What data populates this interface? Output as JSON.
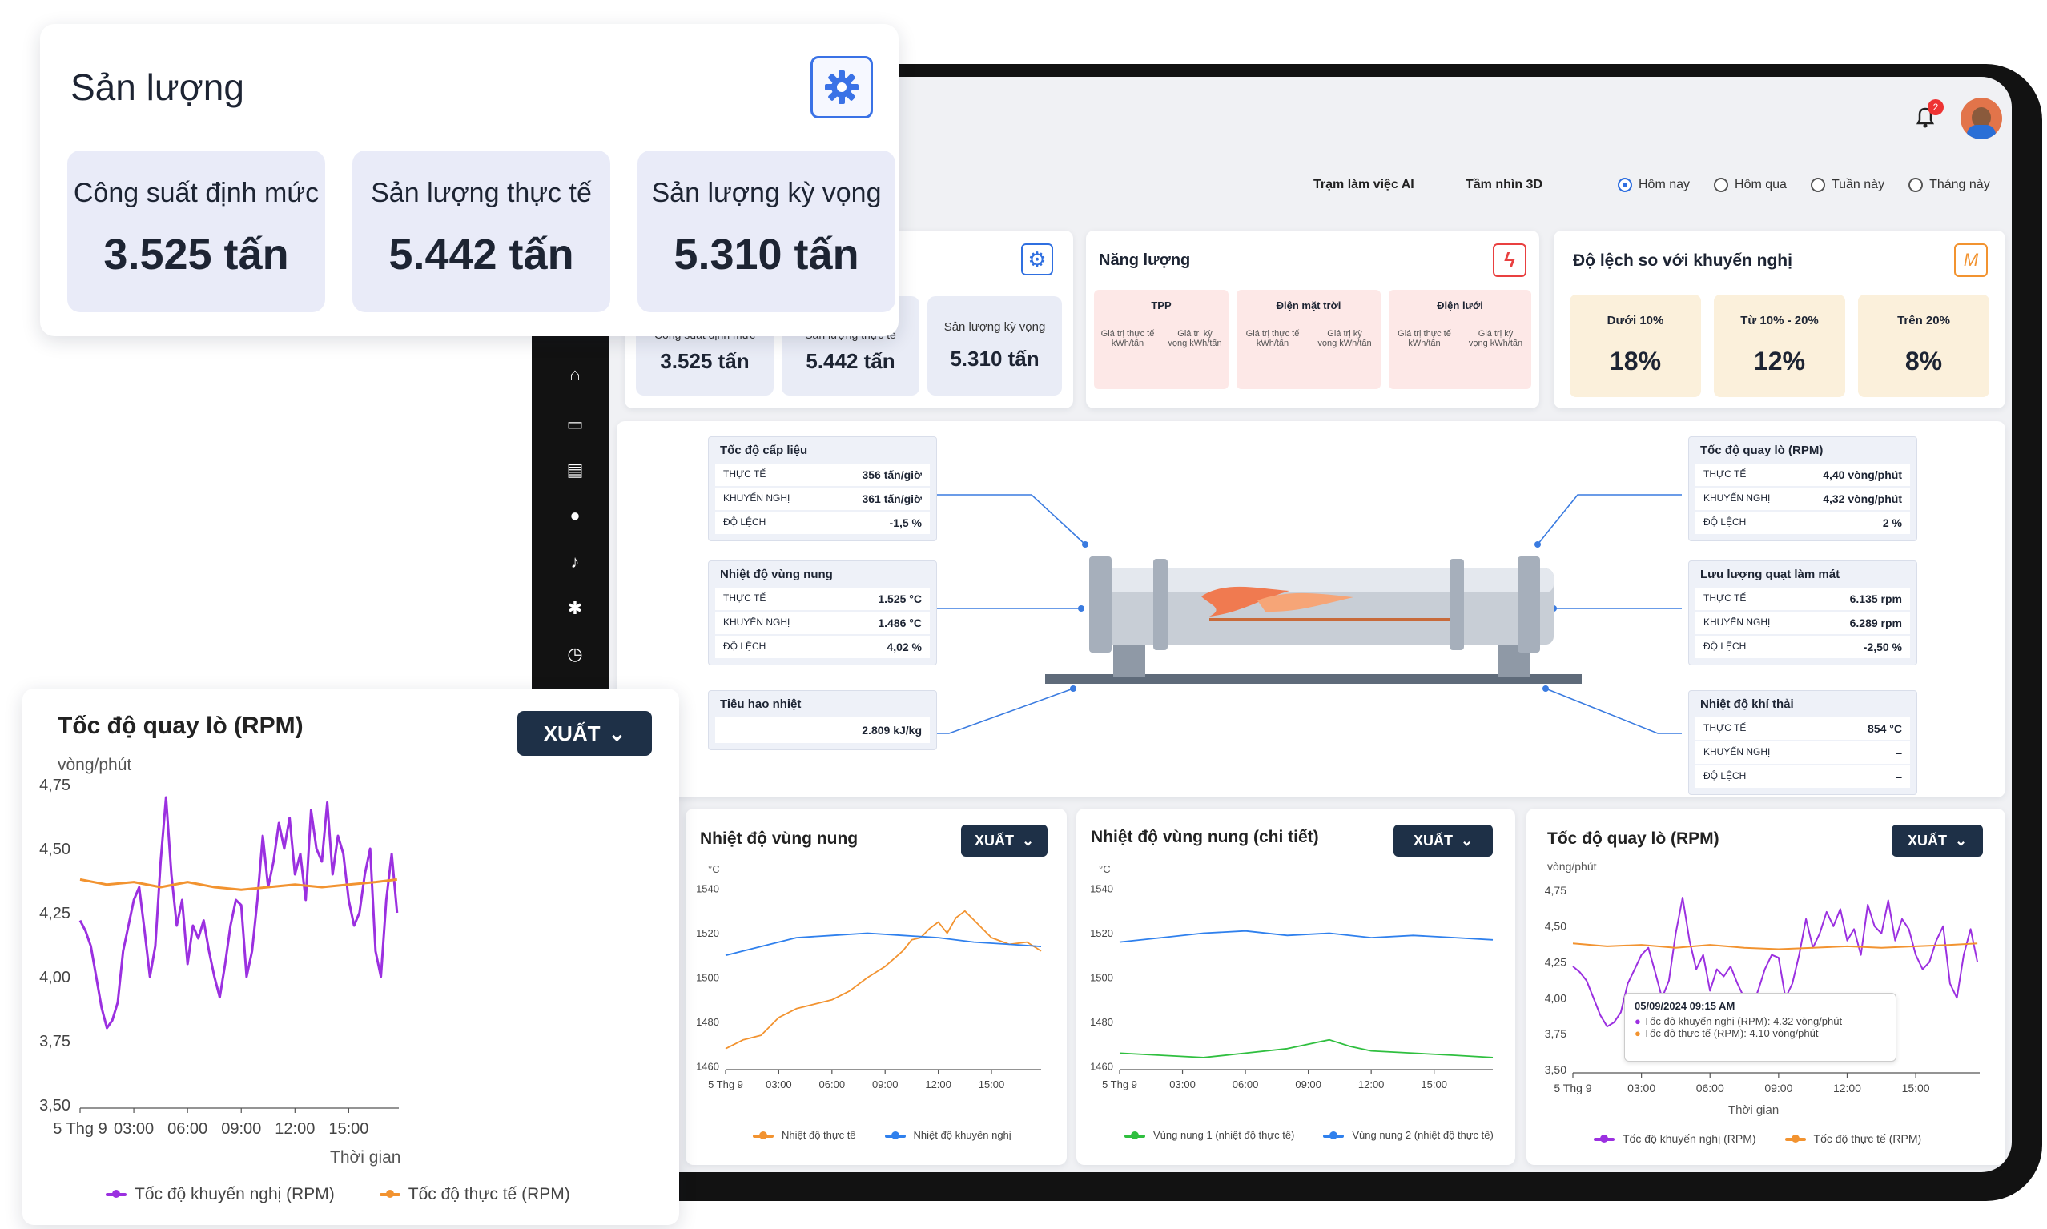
{
  "top_bar": {
    "notification_count": "2",
    "nav_links": [
      "Trạm làm việc AI",
      "Tầm nhìn 3D"
    ],
    "period_options": [
      "Hôm nay",
      "Hôm qua",
      "Tuần này",
      "Tháng này"
    ],
    "period_selected": "Hôm nay"
  },
  "production_overlay": {
    "title": "Sản lượng",
    "kpis": [
      {
        "label": "Công suất định mức",
        "value": "3.525 tấn"
      },
      {
        "label": "Sản lượng thực tế",
        "value": "5.442 tấn"
      },
      {
        "label": "Sản lượng kỳ vọng",
        "value": "5.310 tấn"
      }
    ]
  },
  "production_card": {
    "kpis": [
      {
        "label": "Công suất định mức",
        "value": "3.525 tấn"
      },
      {
        "label": "Sản lượng thực tế",
        "value": "5.442 tấn"
      },
      {
        "label": "Sản lượng kỳ vọng",
        "value": "5.310 tấn"
      }
    ]
  },
  "energy_card": {
    "title": "Năng lượng",
    "columns": [
      {
        "header": "TPP",
        "sub": [
          "Giá trị thực tế kWh/tấn",
          "Giá trị kỳ vọng kWh/tấn"
        ]
      },
      {
        "header": "Điện mặt trời",
        "sub": [
          "Giá trị thực tế kWh/tấn",
          "Giá trị kỳ vọng kWh/tấn"
        ]
      },
      {
        "header": "Điện lưới",
        "sub": [
          "Giá trị thực tế kWh/tấn",
          "Giá trị kỳ vọng kWh/tấn"
        ]
      }
    ]
  },
  "deviation_card": {
    "title": "Độ lệch so với khuyến nghị",
    "items": [
      {
        "label": "Dưới 10%",
        "value": "18%"
      },
      {
        "label": "Từ 10% - 20%",
        "value": "12%"
      },
      {
        "label": "Trên 20%",
        "value": "8%"
      }
    ]
  },
  "kiln_panels": {
    "feed_rate": {
      "title": "Tốc độ cấp liệu",
      "rows": [
        [
          "THỰC TẾ",
          "356 tấn/giờ"
        ],
        [
          "KHUYẾN NGHỊ",
          "361 tấn/giờ"
        ],
        [
          "ĐỘ LỆCH",
          "-1,5 %"
        ]
      ]
    },
    "burn_zone_temp": {
      "title": "Nhiệt độ vùng nung",
      "rows": [
        [
          "THỰC TẾ",
          "1.525 °C"
        ],
        [
          "KHUYẾN NGHỊ",
          "1.486 °C"
        ],
        [
          "ĐỘ LỆCH",
          "4,02 %"
        ]
      ]
    },
    "heat_consumption": {
      "title": "Tiêu hao nhiệt",
      "value": "2.809 kJ/kg"
    },
    "kiln_rpm": {
      "title": "Tốc độ quay lò (RPM)",
      "rows": [
        [
          "THỰC TẾ",
          "4,40 vòng/phút"
        ],
        [
          "KHUYẾN NGHỊ",
          "4,32 vòng/phút"
        ],
        [
          "ĐỘ LỆCH",
          "2 %"
        ]
      ]
    },
    "cooling_fan": {
      "title": "Lưu lượng quạt làm mát",
      "rows": [
        [
          "THỰC TẾ",
          "6.135 rpm"
        ],
        [
          "KHUYẾN NGHỊ",
          "6.289 rpm"
        ],
        [
          "ĐỘ LỆCH",
          "-2,50 %"
        ]
      ]
    },
    "exhaust_temp": {
      "title": "Nhiệt độ khí thải",
      "rows": [
        [
          "THỰC TẾ",
          "854 °C"
        ],
        [
          "KHUYẾN NGHỊ",
          "–"
        ],
        [
          "ĐỘ LỆCH",
          "–"
        ]
      ]
    }
  },
  "export_label": "XUẤT",
  "chart_data": [
    {
      "id": "rpm_big",
      "type": "line",
      "title": "Tốc độ quay lò (RPM)",
      "ylabel": "vòng/phút",
      "xlabel": "Thời gian",
      "ylim": [
        3.5,
        4.75
      ],
      "yticks": [
        "4,75",
        "4,50",
        "4,25",
        "4,00",
        "3,75",
        "3,50"
      ],
      "ytick_values": [
        4.75,
        4.5,
        4.25,
        4.0,
        3.75,
        3.5
      ],
      "xticks": [
        "5 Thg 9",
        "03:00",
        "06:00",
        "09:00",
        "12:00",
        "15:00"
      ],
      "xtick_values": [
        0,
        3,
        6,
        9,
        12,
        15
      ],
      "xlim": [
        0,
        17.8
      ],
      "series": [
        {
          "name": "Tốc độ khuyến nghị (RPM)",
          "color": "#9b30e0",
          "x": [
            0,
            0.3,
            0.6,
            0.9,
            1.2,
            1.5,
            1.8,
            2.1,
            2.4,
            2.7,
            3.0,
            3.3,
            3.6,
            3.9,
            4.2,
            4.5,
            4.8,
            5.1,
            5.4,
            5.7,
            6.0,
            6.3,
            6.6,
            6.9,
            7.2,
            7.5,
            7.8,
            8.1,
            8.4,
            8.7,
            9.0,
            9.3,
            9.6,
            9.9,
            10.2,
            10.5,
            10.8,
            11.1,
            11.4,
            11.7,
            12.0,
            12.3,
            12.6,
            12.9,
            13.2,
            13.5,
            13.8,
            14.1,
            14.4,
            14.7,
            15.0,
            15.3,
            15.6,
            15.9,
            16.2,
            16.5,
            16.8,
            17.1,
            17.4,
            17.7
          ],
          "y": [
            4.22,
            4.18,
            4.12,
            4.0,
            3.88,
            3.8,
            3.83,
            3.9,
            4.1,
            4.2,
            4.3,
            4.35,
            4.18,
            4.0,
            4.12,
            4.45,
            4.7,
            4.4,
            4.2,
            4.3,
            4.05,
            4.2,
            4.15,
            4.22,
            4.1,
            4.0,
            3.92,
            4.05,
            4.2,
            4.3,
            4.28,
            4.0,
            4.1,
            4.3,
            4.55,
            4.35,
            4.45,
            4.6,
            4.5,
            4.62,
            4.4,
            4.48,
            4.3,
            4.65,
            4.5,
            4.45,
            4.68,
            4.4,
            4.55,
            4.48,
            4.3,
            4.2,
            4.25,
            4.4,
            4.5,
            4.1,
            4.0,
            4.3,
            4.48,
            4.25
          ]
        },
        {
          "name": "Tốc độ thực tế (RPM)",
          "color": "#f29330",
          "x": [
            0,
            1.5,
            3,
            4.5,
            6,
            7.5,
            9,
            10.5,
            12,
            13.5,
            15,
            16.5,
            17.7
          ],
          "y": [
            4.38,
            4.36,
            4.37,
            4.35,
            4.37,
            4.35,
            4.34,
            4.35,
            4.36,
            4.35,
            4.36,
            4.37,
            4.38
          ]
        }
      ]
    },
    {
      "id": "burn_temp",
      "type": "line",
      "title": "Nhiệt độ vùng nung",
      "ylabel": "°C",
      "ylim": [
        1460,
        1540
      ],
      "yticks": [
        "1540",
        "1520",
        "1500",
        "1480",
        "1460"
      ],
      "ytick_values": [
        1540,
        1520,
        1500,
        1480,
        1460
      ],
      "xticks": [
        "5 Thg 9",
        "03:00",
        "06:00",
        "09:00",
        "12:00",
        "15:00"
      ],
      "xtick_values": [
        0,
        3,
        6,
        9,
        12,
        15
      ],
      "xlim": [
        0,
        17.8
      ],
      "series": [
        {
          "name": "Nhiệt độ thực tế",
          "color": "#f29330",
          "x": [
            0,
            1,
            2,
            3,
            4,
            5,
            6,
            7,
            8,
            9,
            10,
            10.5,
            11,
            11.5,
            12,
            12.5,
            13,
            13.5,
            14,
            15,
            16,
            17,
            17.8
          ],
          "y": [
            1468,
            1472,
            1474,
            1482,
            1486,
            1488,
            1490,
            1494,
            1500,
            1505,
            1512,
            1517,
            1518,
            1522,
            1525,
            1520,
            1527,
            1530,
            1526,
            1518,
            1515,
            1516,
            1512
          ]
        },
        {
          "name": "Nhiệt độ khuyến nghị",
          "color": "#2f80ed",
          "x": [
            0,
            2,
            4,
            6,
            8,
            10,
            12,
            14,
            16,
            17.8
          ],
          "y": [
            1510,
            1514,
            1518,
            1519,
            1520,
            1519,
            1518,
            1516,
            1515,
            1514
          ]
        }
      ]
    },
    {
      "id": "burn_temp_detail",
      "type": "line",
      "title": "Nhiệt độ vùng nung (chi tiết)",
      "ylabel": "°C",
      "ylim": [
        1460,
        1540
      ],
      "yticks": [
        "1540",
        "1520",
        "1500",
        "1480",
        "1460"
      ],
      "ytick_values": [
        1540,
        1520,
        1500,
        1480,
        1460
      ],
      "xticks": [
        "5 Thg 9",
        "03:00",
        "06:00",
        "09:00",
        "12:00",
        "15:00"
      ],
      "xtick_values": [
        0,
        3,
        6,
        9,
        12,
        15
      ],
      "xlim": [
        0,
        17.8
      ],
      "series": [
        {
          "name": "Vùng nung 1 (nhiệt độ thực tế)",
          "color": "#2fbf3f",
          "x": [
            0,
            2,
            4,
            6,
            8,
            10,
            11,
            12,
            14,
            16,
            17.8
          ],
          "y": [
            1466,
            1465,
            1464,
            1466,
            1468,
            1472,
            1469,
            1467,
            1466,
            1465,
            1464
          ]
        },
        {
          "name": "Vùng nung 2 (nhiệt độ thực tế)",
          "color": "#2f80ed",
          "x": [
            0,
            2,
            4,
            6,
            8,
            10,
            12,
            14,
            16,
            17.8
          ],
          "y": [
            1516,
            1518,
            1520,
            1521,
            1519,
            1520,
            1518,
            1519,
            1518,
            1517
          ]
        }
      ]
    },
    {
      "id": "rpm_small",
      "type": "line",
      "title": "Tốc độ quay lò (RPM)",
      "ylabel": "vòng/phút",
      "xlabel": "Thời gian",
      "ylim": [
        3.5,
        4.75
      ],
      "yticks": [
        "4,75",
        "4,50",
        "4,25",
        "4,00",
        "3,75",
        "3,50"
      ],
      "ytick_values": [
        4.75,
        4.5,
        4.25,
        4.0,
        3.75,
        3.5
      ],
      "xticks": [
        "5 Thg 9",
        "03:00",
        "06:00",
        "09:00",
        "12:00",
        "15:00"
      ],
      "xtick_values": [
        0,
        3,
        6,
        9,
        12,
        15
      ],
      "xlim": [
        0,
        17.8
      ],
      "tooltip": {
        "date": "05/09/2024 09:15 AM",
        "lines": [
          "Tốc độ khuyến nghị (RPM): 4.32 vòng/phút",
          "Tốc độ thực tế (RPM): 4.10 vòng/phút"
        ]
      },
      "series": [
        {
          "name": "Tốc độ khuyến nghị (RPM)",
          "color": "#9b30e0",
          "x": [
            0,
            0.3,
            0.6,
            0.9,
            1.2,
            1.5,
            1.8,
            2.1,
            2.4,
            2.7,
            3.0,
            3.3,
            3.6,
            3.9,
            4.2,
            4.5,
            4.8,
            5.1,
            5.4,
            5.7,
            6.0,
            6.3,
            6.6,
            6.9,
            7.2,
            7.5,
            7.8,
            8.1,
            8.4,
            8.7,
            9.0,
            9.3,
            9.6,
            9.9,
            10.2,
            10.5,
            10.8,
            11.1,
            11.4,
            11.7,
            12.0,
            12.3,
            12.6,
            12.9,
            13.2,
            13.5,
            13.8,
            14.1,
            14.4,
            14.7,
            15.0,
            15.3,
            15.6,
            15.9,
            16.2,
            16.5,
            16.8,
            17.1,
            17.4,
            17.7
          ],
          "y": [
            4.22,
            4.18,
            4.12,
            4.0,
            3.88,
            3.8,
            3.83,
            3.9,
            4.1,
            4.2,
            4.3,
            4.35,
            4.18,
            4.0,
            4.12,
            4.45,
            4.7,
            4.4,
            4.2,
            4.3,
            4.05,
            4.2,
            4.15,
            4.22,
            4.1,
            4.0,
            3.92,
            4.05,
            4.2,
            4.3,
            4.28,
            4.0,
            4.1,
            4.3,
            4.55,
            4.35,
            4.45,
            4.6,
            4.5,
            4.62,
            4.4,
            4.48,
            4.3,
            4.65,
            4.5,
            4.45,
            4.68,
            4.4,
            4.55,
            4.48,
            4.3,
            4.2,
            4.25,
            4.4,
            4.5,
            4.1,
            4.0,
            4.3,
            4.48,
            4.25
          ]
        },
        {
          "name": "Tốc độ thực tế (RPM)",
          "color": "#f29330",
          "x": [
            0,
            1.5,
            3,
            4.5,
            6,
            7.5,
            9,
            10.5,
            12,
            13.5,
            15,
            16.5,
            17.7
          ],
          "y": [
            4.38,
            4.36,
            4.37,
            4.35,
            4.37,
            4.35,
            4.34,
            4.35,
            4.36,
            4.35,
            4.36,
            4.37,
            4.38
          ]
        }
      ]
    }
  ]
}
